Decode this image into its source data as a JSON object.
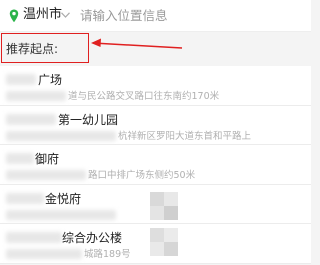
{
  "search": {
    "city": "温州市",
    "placeholder": "请输入位置信息"
  },
  "section": {
    "title": "推荐起点:"
  },
  "list": [
    {
      "name": "广场",
      "address": "道与民公路交叉路口往东南约170米"
    },
    {
      "name": "第一幼儿园",
      "address": "杭祥新区罗阳大道东首和平路上"
    },
    {
      "name": "御府",
      "address": "路口中排广场东侧约50米"
    },
    {
      "name": "金悦府",
      "address": ""
    },
    {
      "name": "综合办公楼",
      "address": "城路189号"
    }
  ],
  "colors": {
    "pin": "#2bb34a",
    "annotation": "#e02020"
  }
}
